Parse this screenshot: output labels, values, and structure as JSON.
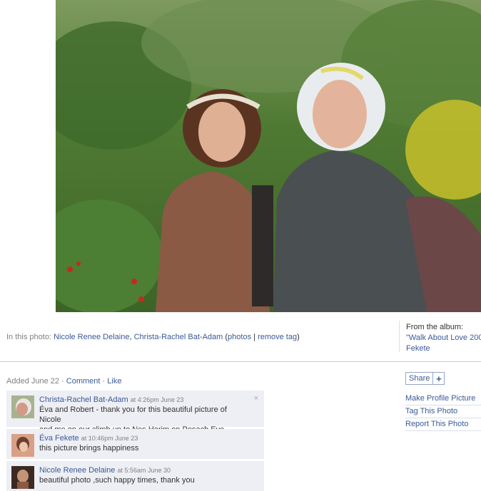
{
  "tags": {
    "prefix": "In this photo:",
    "people": [
      "Nicole Renee Delaine",
      "Christa-Rachel Bat-Adam"
    ],
    "photos_link": "photos",
    "remove_tag": "remove tag"
  },
  "album": {
    "label": "From the album:",
    "name": "\"Walk About Love 200",
    "owner": "Fekete"
  },
  "feedback": {
    "added": "Added June 22",
    "comment_link": "Comment",
    "like_link": "Like"
  },
  "comments": [
    {
      "author": "Christa-Rachel Bat-Adam",
      "time": "at 4:26pm June 23",
      "text_line1": "Éva and Robert - thank you for this beautiful picture of Nicole",
      "text_line2": "and me on our climb up to Nes Harim on Pesach Eve",
      "close": "×"
    },
    {
      "author": "Éva Fekete",
      "time": "at 10:46pm June 23",
      "text_line1": "this picture brings happiness"
    },
    {
      "author": "Nicole Renee Delaine",
      "time": "at 5:56am June 30",
      "text_line1": "beautiful photo ,such happy times, thank you"
    }
  ],
  "actions": {
    "share": "Share",
    "share_plus": "+",
    "items": [
      "Make Profile Picture",
      "Tag This Photo",
      "Report This Photo"
    ]
  },
  "colors": {
    "link": "#3b5998",
    "comment_bg": "#edeff4",
    "muted": "#808080"
  }
}
